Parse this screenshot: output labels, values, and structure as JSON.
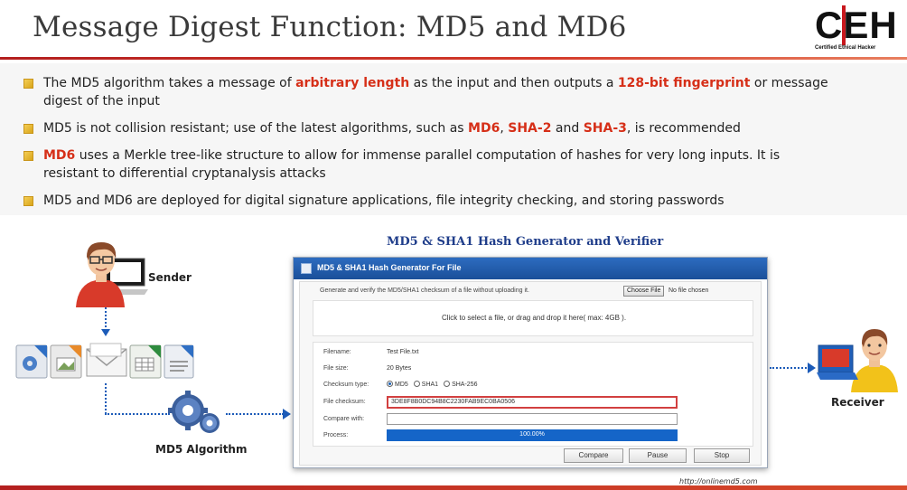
{
  "slide": {
    "title": "Message Digest Function: MD5 and MD6",
    "logo": {
      "letters": "CEH",
      "subtitle": "Certified  Ethical  Hacker"
    }
  },
  "bullets": [
    {
      "parts": [
        {
          "text": "The MD5 algorithm takes a message of ",
          "hl": false
        },
        {
          "text": "arbitrary length",
          "hl": true
        },
        {
          "text": " as the input and then outputs a ",
          "hl": false
        },
        {
          "text": "128-bit fingerprint",
          "hl": true
        },
        {
          "text": " or message digest of the input",
          "hl": false
        }
      ]
    },
    {
      "parts": [
        {
          "text": "MD5 is not collision resistant; use of the latest algorithms, such as ",
          "hl": false
        },
        {
          "text": "MD6",
          "hl": true
        },
        {
          "text": ", ",
          "hl": false
        },
        {
          "text": "SHA-2",
          "hl": true
        },
        {
          "text": " and ",
          "hl": false
        },
        {
          "text": "SHA-3",
          "hl": true
        },
        {
          "text": ", is recommended",
          "hl": false
        }
      ]
    },
    {
      "parts": [
        {
          "text": "MD6",
          "hl": true
        },
        {
          "text": " uses a Merkle tree-like structure to allow for immense parallel computation of hashes for very long inputs. It is resistant to differential cryptanalysis attacks",
          "hl": false
        }
      ]
    },
    {
      "parts": [
        {
          "text": "MD5 and MD6 are deployed for digital signature applications, file integrity checking, and storing passwords",
          "hl": false
        }
      ]
    }
  ],
  "diagram": {
    "title": "MD5 & SHA1 Hash Generator and Verifier",
    "sender_label": "Sender",
    "receiver_label": "Receiver",
    "algorithm_label": "MD5 Algorithm",
    "file_type_icons": [
      "gear-file-icon",
      "image-file-icon",
      "envelope-icon",
      "spreadsheet-file-icon",
      "document-file-icon"
    ]
  },
  "tool": {
    "window_title": "MD5 & SHA1 Hash Generator For File",
    "intro": "Generate and verify the MD5/SHA1 checksum of a file without uploading it.",
    "choose_file_label": "Choose File",
    "no_file_text": "No file chosen",
    "drop_text": "Click to select a file, or drag and drop it here( max: 4GB ).",
    "labels": {
      "filename": "Filename:",
      "filesize": "File size:",
      "checksum_type": "Checksum type:",
      "file_checksum": "File checksum:",
      "compare_with": "Compare with:",
      "process": "Process:"
    },
    "filename": "Test File.txt",
    "filesize": "20 Bytes",
    "checksum_options": [
      "MD5",
      "SHA1",
      "SHA-256"
    ],
    "checksum_selected": "MD5",
    "checksum_value": "3DE8F8B0DC94B8C2230FAB9EC0BA0506",
    "compare_value": "",
    "progress_text": "100.00%",
    "progress_fraction": 1.0,
    "buttons": {
      "compare": "Compare",
      "pause": "Pause",
      "stop": "Stop"
    },
    "source_url": "http://onlinemd5.com"
  },
  "colors": {
    "accent_red": "#d62f18",
    "connector_blue": "#1c5bb8",
    "window_header_blue": "#1a4f99",
    "progress_blue": "#1565c8"
  }
}
